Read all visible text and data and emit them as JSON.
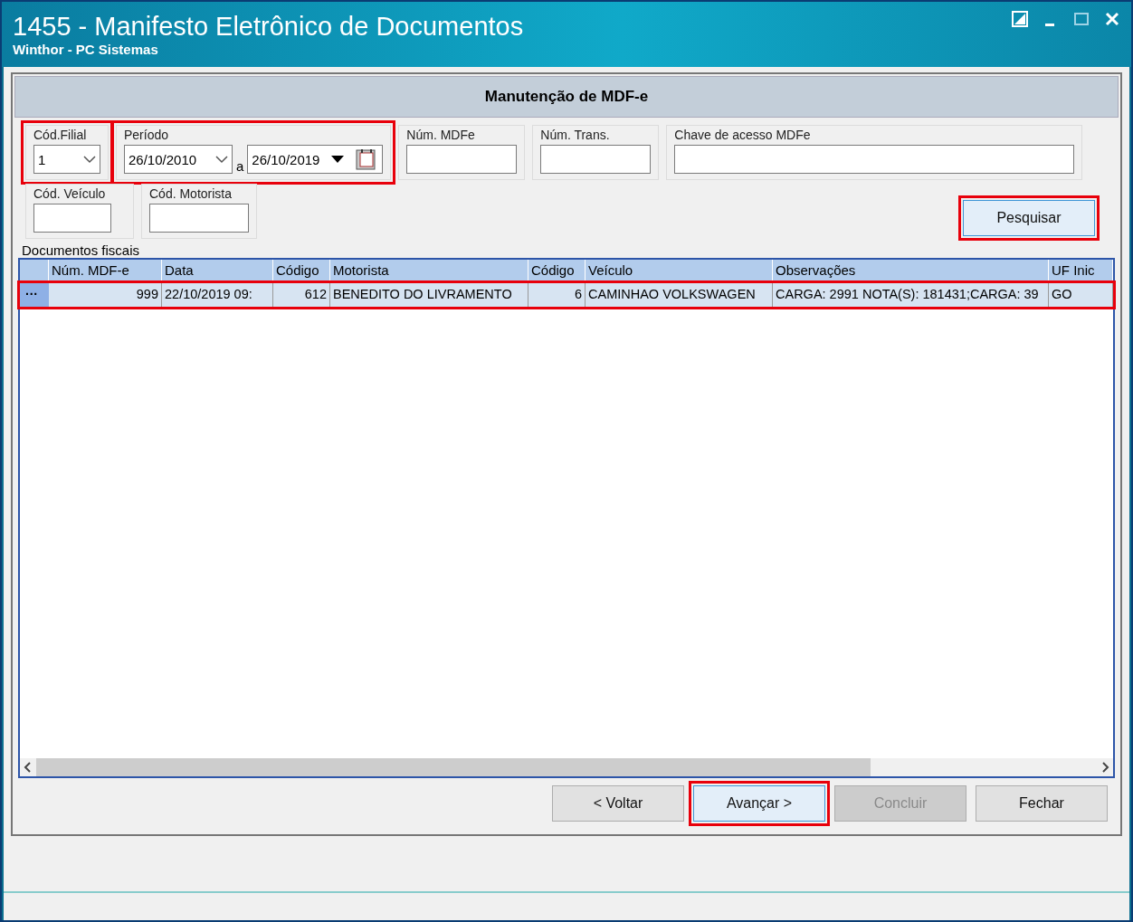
{
  "window": {
    "title": "1455 - Manifesto Eletrônico de Documentos",
    "subtitle": "Winthor - PC Sistemas"
  },
  "header": "Manutenção de MDF-e",
  "filters": [
    {
      "kind": "combo",
      "label": "Cód.Filial",
      "value": "1",
      "highlighted": true
    },
    {
      "kind": "period",
      "label": "Período",
      "from": "26/10/2010",
      "separator": "a",
      "to": "26/10/2019",
      "highlighted": true
    },
    {
      "kind": "text",
      "label": "Núm. MDFe"
    },
    {
      "kind": "text",
      "label": "Núm. Trans."
    },
    {
      "kind": "wide",
      "label": "Chave de acesso MDFe"
    },
    {
      "kind": "text",
      "label": "Cód. Veículo"
    },
    {
      "kind": "text",
      "label": "Cód. Motorista"
    }
  ],
  "search_button": {
    "label": "Pesquisar",
    "highlighted": true
  },
  "table": {
    "title": "Documentos fiscais",
    "columns": [
      "Núm. MDF-e",
      "Data",
      "Código",
      "Motorista",
      "Código",
      "Veículo",
      "Observações",
      "UF Inic"
    ],
    "rows": [
      {
        "selected": true,
        "highlighted": true,
        "indicator": "···",
        "cells": [
          "999",
          "22/10/2019 09:",
          "612",
          "BENEDITO DO LIVRAMENTO",
          "6",
          "CAMINHAO VOLKSWAGEN",
          "CARGA: 2991 NOTA(S): 181431;CARGA: 39",
          "GO"
        ]
      }
    ]
  },
  "buttons": [
    {
      "label": "< Voltar",
      "disabled": false,
      "highlighted": false
    },
    {
      "label": "Avançar >",
      "disabled": false,
      "highlighted": true
    },
    {
      "label": "Concluir",
      "disabled": true,
      "highlighted": false
    },
    {
      "label": "Fechar",
      "disabled": false,
      "highlighted": false
    }
  ]
}
